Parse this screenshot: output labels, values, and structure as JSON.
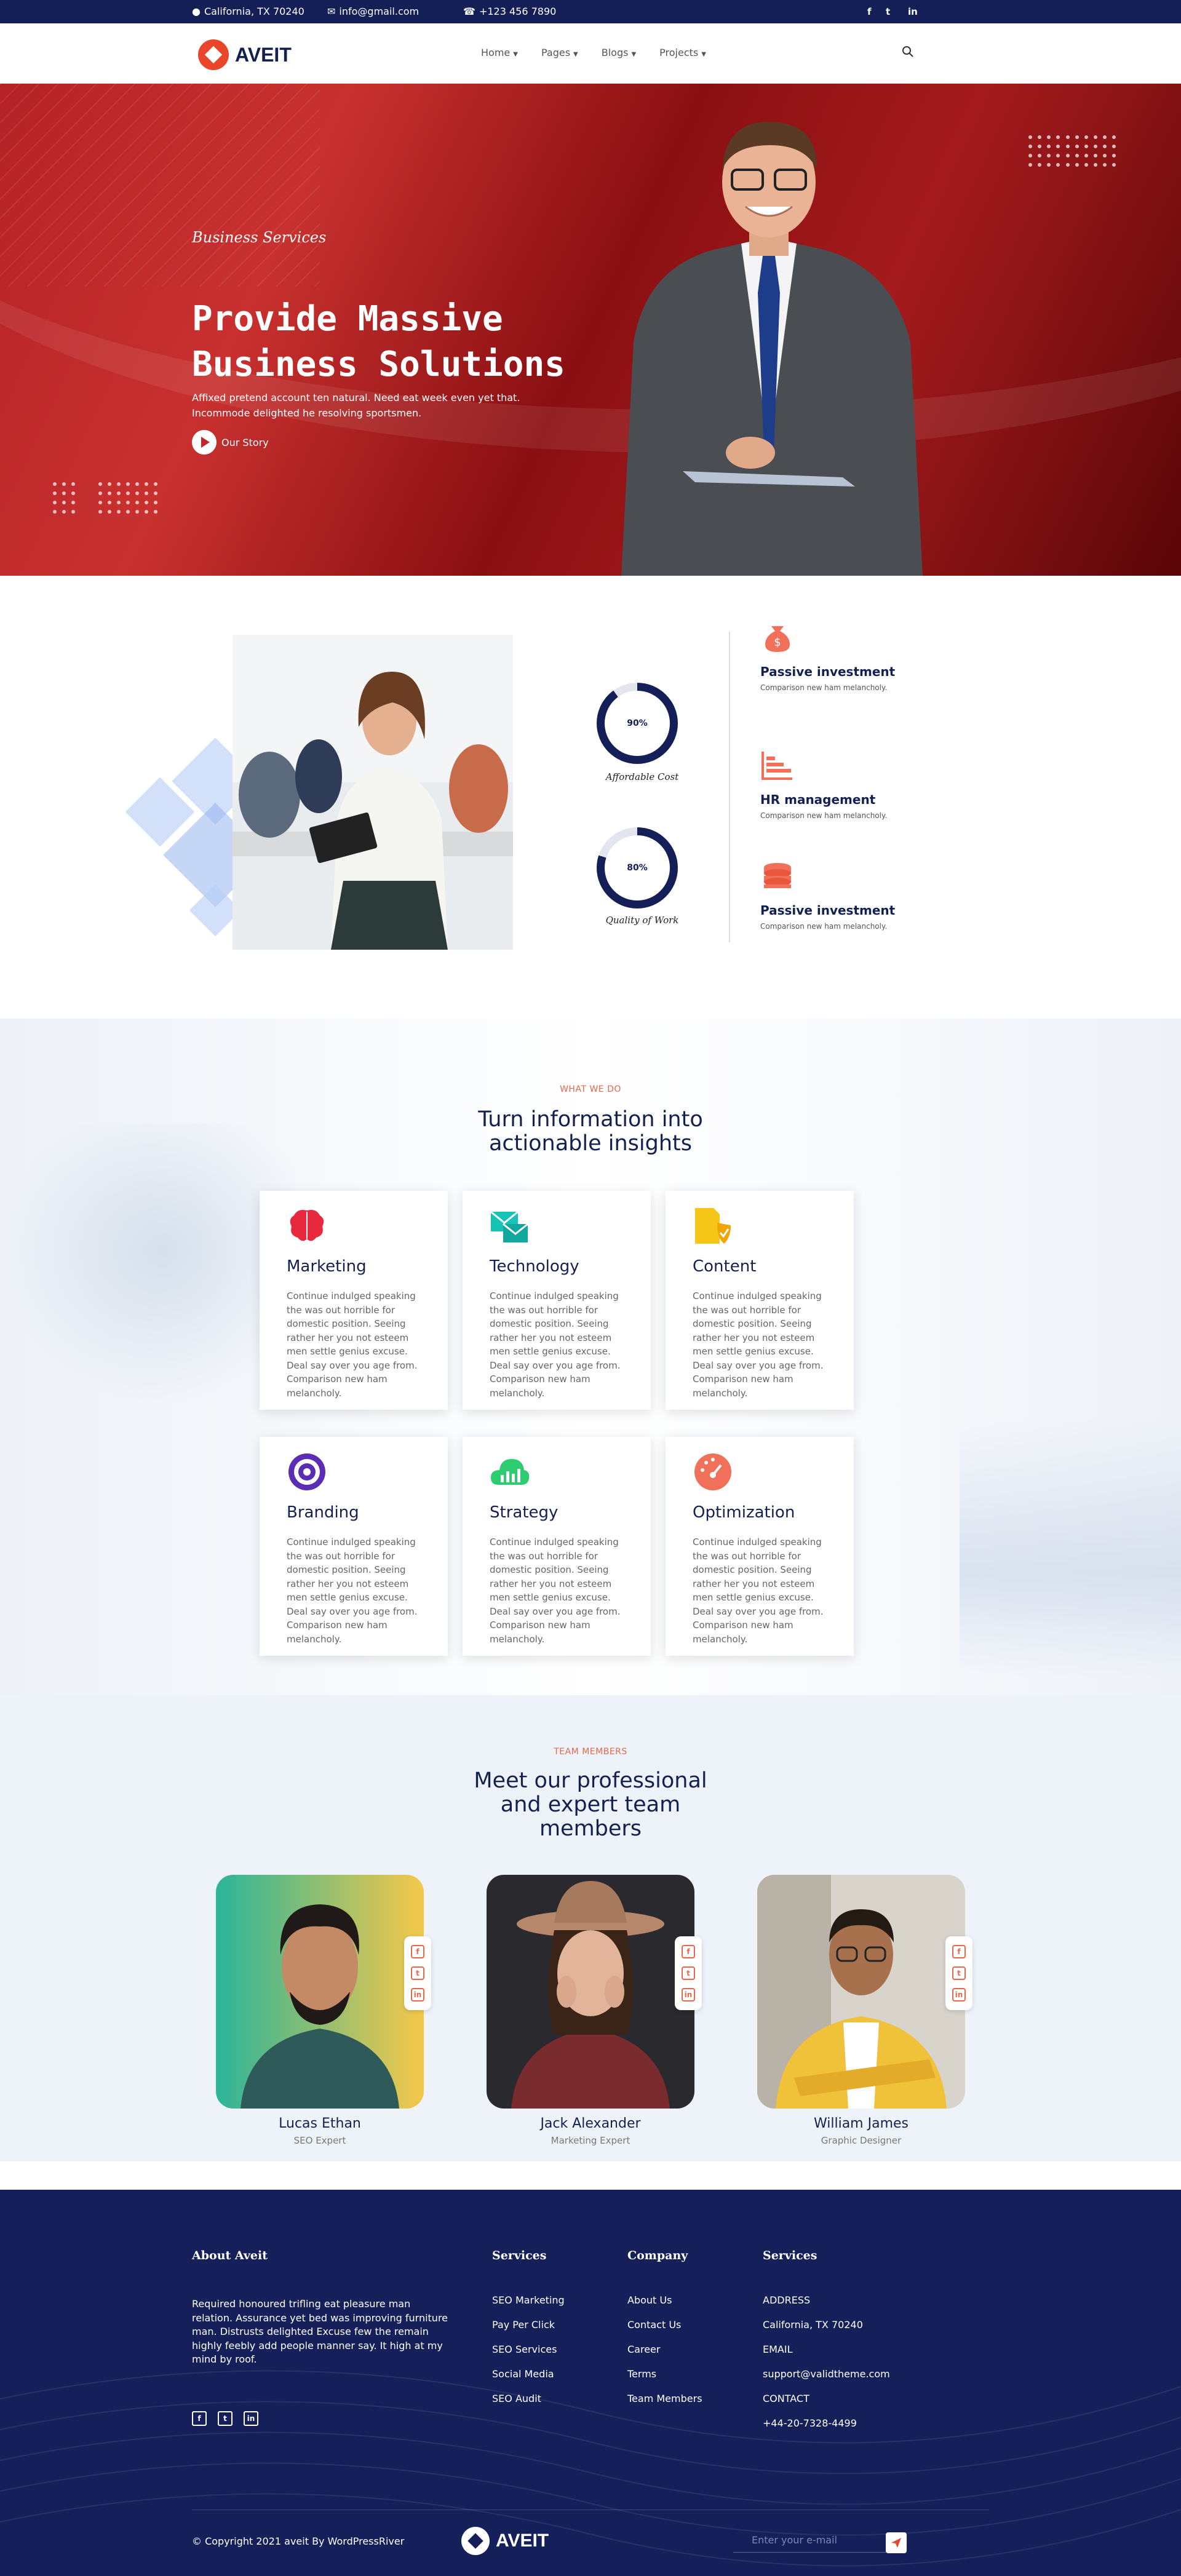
{
  "topbar": {
    "address": "California, TX 70240",
    "email": "info@gmail.com",
    "phone": "+123 456 7890",
    "social": [
      "facebook-icon",
      "twitter-icon",
      "linkedin-icon"
    ]
  },
  "brand": {
    "name": "AVEIT",
    "accent": "#e8462a",
    "navy": "#141f58"
  },
  "nav": [
    {
      "label": "Home"
    },
    {
      "label": "Pages"
    },
    {
      "label": "Blogs"
    },
    {
      "label": "Projects"
    }
  ],
  "hero": {
    "subtitle": "Business Services",
    "title_line1": "Provide Massive",
    "title_line2": "Business Solutions",
    "description": "Affixed pretend account ten natural. Need eat week even yet that. Incommode delighted he resolving sportsmen.",
    "cta": "Our Story"
  },
  "stats": {
    "circles": [
      {
        "value": "90%",
        "label": "Affordable Cost",
        "fraction": 0.9
      },
      {
        "value": "80%",
        "label": "Quality of Work",
        "fraction": 0.8
      }
    ],
    "features": [
      {
        "title": "Passive investment",
        "desc": "Comparison new ham melancholy.",
        "icon": "money-bag-icon"
      },
      {
        "title": "HR management",
        "desc": "Comparison new ham melancholy.",
        "icon": "bar-chart-icon"
      },
      {
        "title": "Passive investment",
        "desc": "Comparison new ham melancholy.",
        "icon": "coins-icon"
      }
    ]
  },
  "services": {
    "kicker": "WHAT WE DO",
    "heading_line1": "Turn information into",
    "heading_line2": "actionable insights",
    "cards": [
      {
        "title": "Marketing",
        "desc": "Continue indulged speaking the was out horrible for domestic position. Seeing rather her you not esteem men settle genius excuse. Deal say over you age from. Comparison new ham melancholy.",
        "icon": "brain-icon",
        "color": "#e8283c"
      },
      {
        "title": "Technology",
        "desc": "Continue indulged speaking the was out horrible for domestic position. Seeing rather her you not esteem men settle genius excuse. Deal say over you age from. Comparison new ham melancholy.",
        "icon": "mail-icon",
        "color": "#16c3b7"
      },
      {
        "title": "Content",
        "desc": "Continue indulged speaking the was out horrible for domestic position. Seeing rather her you not esteem men settle genius excuse. Deal say over you age from. Comparison new ham melancholy.",
        "icon": "document-shield-icon",
        "color": "#f5c518"
      },
      {
        "title": "Branding",
        "desc": "Continue indulged speaking the was out horrible for domestic position. Seeing rather her you not esteem men settle genius excuse. Deal say over you age from. Comparison new ham melancholy.",
        "icon": "target-icon",
        "color": "#5a2db4"
      },
      {
        "title": "Strategy",
        "desc": "Continue indulged speaking the was out horrible for domestic position. Seeing rather her you not esteem men settle genius excuse. Deal say over you age from. Comparison new ham melancholy.",
        "icon": "cloud-chart-icon",
        "color": "#2ecc71"
      },
      {
        "title": "Optimization",
        "desc": "Continue indulged speaking the was out horrible for domestic position. Seeing rather her you not esteem men settle genius excuse. Deal say over you age from. Comparison new ham melancholy.",
        "icon": "gauge-icon",
        "color": "#f0705a"
      }
    ]
  },
  "team": {
    "kicker": "TEAM MEMBERS",
    "heading_line1": "Meet our professional",
    "heading_line2": "and expert team",
    "heading_line3": "members",
    "members": [
      {
        "name": "Lucas Ethan",
        "role": "SEO Expert"
      },
      {
        "name": "Jack Alexander",
        "role": "Marketing Expert"
      },
      {
        "name": "William James",
        "role": "Graphic Designer"
      }
    ]
  },
  "footer": {
    "about_title": "About Aveit",
    "about_text": "Required honoured trifling eat pleasure man relation. Assurance yet bed was improving furniture man. Distrusts delighted Excuse few the remain highly feebly add people manner say. It high at my mind by roof.",
    "services_title": "Services",
    "services": [
      "SEO Marketing",
      "Pay Per Click",
      "SEO Services",
      "Social Media",
      "SEO Audit"
    ],
    "company_title": "Company",
    "company": [
      "About Us",
      "Contact Us",
      "Career",
      "Terms",
      "Team Members"
    ],
    "contact_title": "Services",
    "contact": [
      "ADDRESS",
      "California, TX 70240",
      "EMAIL",
      "support@validtheme.com",
      "CONTACT",
      "+44-20-7328-4499"
    ],
    "copyright": "© Copyright 2021 aveit By WordPressRiver",
    "email_placeholder": "Enter your e-mail"
  }
}
